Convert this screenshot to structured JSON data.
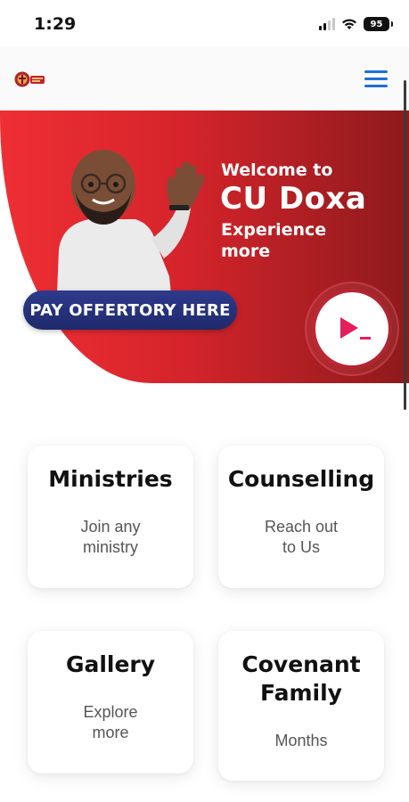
{
  "status_bar": {
    "time": "1:29",
    "battery": "95",
    "icons": [
      "signal-icon",
      "wifi-icon",
      "battery-icon"
    ]
  },
  "nav": {
    "logo_icon": "church-logo-icon",
    "menu_icon": "hamburger-menu-icon",
    "accent_color": "#1e6fd9"
  },
  "hero": {
    "welcome": "Welcome to",
    "brand": "CU Doxa",
    "tagline_line1": "Experience",
    "tagline_line2": "more",
    "offertory_label": "PAY OFFERTORY HERE",
    "play_icon": "play-cursor-icon",
    "colors": {
      "gradient_start": "#ee2f34",
      "gradient_end": "#8d1a1c",
      "offertory_bg": "#2e3a8c"
    }
  },
  "cards": {
    "ministries": {
      "title": "Ministries",
      "sub_line1": "Join any",
      "sub_line2": "ministry"
    },
    "counselling": {
      "title": "Counselling",
      "sub_line1": "Reach out",
      "sub_line2": "to Us"
    },
    "gallery": {
      "title": "Gallery",
      "sub_line1": "Explore",
      "sub_line2": "more"
    },
    "covenant": {
      "title_line1": "Covenant",
      "title_line2": "Family",
      "sub_line1": "Months"
    }
  }
}
